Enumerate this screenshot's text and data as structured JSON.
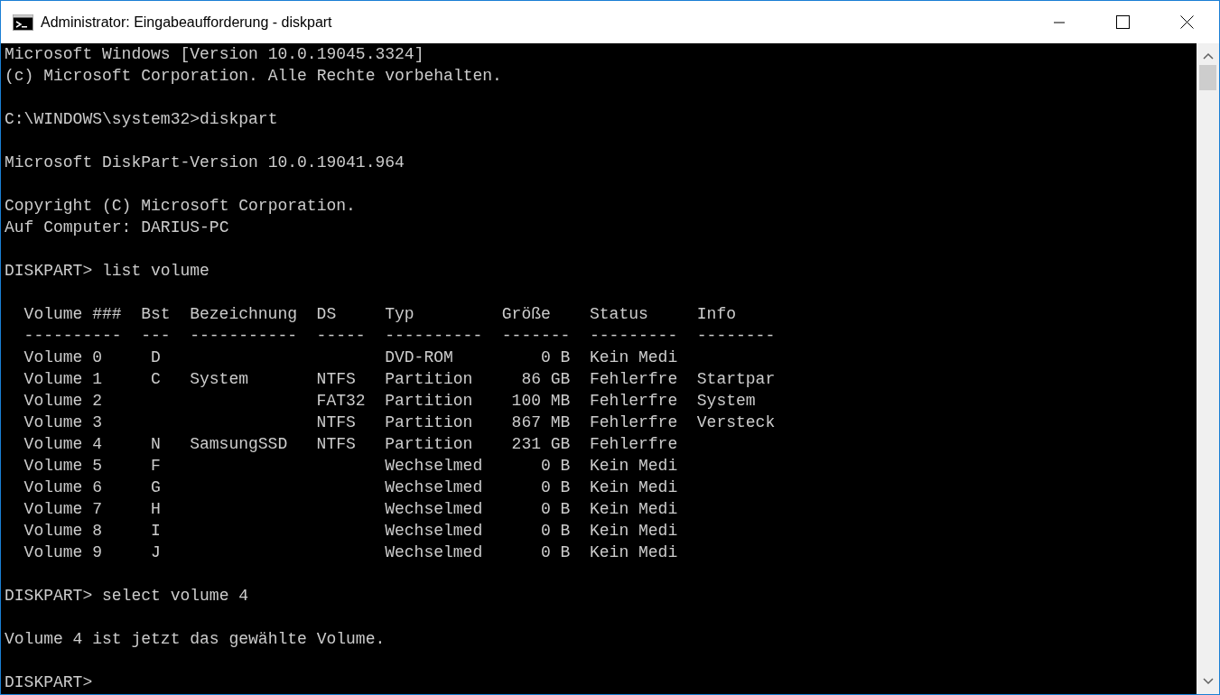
{
  "window": {
    "title": "Administrator: Eingabeaufforderung - diskpart"
  },
  "console_before": [
    [
      "Microsoft Windows [Version 10.0.19045.3324]",
      "(c) Microsoft Corporation. Alle Rechte vorbehalten."
    ],
    [
      "C:\\WINDOWS\\system32>diskpart"
    ],
    [
      "Microsoft DiskPart-Version 10.0.19041.964"
    ],
    [
      "Copyright (C) Microsoft Corporation.",
      "Auf Computer: DARIUS-PC"
    ],
    [
      "DISKPART> list volume"
    ]
  ],
  "table": {
    "columns": [
      "Volume ###",
      "Bst",
      "Bezeichnung",
      "DS",
      "Typ",
      "Größe",
      "Status",
      "Info"
    ],
    "separators": [
      "----------",
      "---",
      "-----------",
      "-----",
      "----------",
      "-------",
      "---------",
      "--------"
    ],
    "rows": [
      {
        "volume": "Volume 0",
        "bst": "D",
        "typ": "DVD-ROM",
        "size": "0 B",
        "status": "Kein Medi"
      },
      {
        "volume": "Volume 1",
        "bst": "C",
        "label": "System",
        "fs": "NTFS",
        "typ": "Partition",
        "size": "86 GB",
        "status": "Fehlerfre",
        "info": "Startpar"
      },
      {
        "volume": "Volume 2",
        "fs": "FAT32",
        "typ": "Partition",
        "size": "100 MB",
        "status": "Fehlerfre",
        "info": "System"
      },
      {
        "volume": "Volume 3",
        "fs": "NTFS",
        "typ": "Partition",
        "size": "867 MB",
        "status": "Fehlerfre",
        "info": "Versteck"
      },
      {
        "volume": "Volume 4",
        "bst": "N",
        "label": "SamsungSSD",
        "fs": "NTFS",
        "typ": "Partition",
        "size": "231 GB",
        "status": "Fehlerfre"
      },
      {
        "volume": "Volume 5",
        "bst": "F",
        "typ": "Wechselmed",
        "size": "0 B",
        "status": "Kein Medi"
      },
      {
        "volume": "Volume 6",
        "bst": "G",
        "typ": "Wechselmed",
        "size": "0 B",
        "status": "Kein Medi"
      },
      {
        "volume": "Volume 7",
        "bst": "H",
        "typ": "Wechselmed",
        "size": "0 B",
        "status": "Kein Medi"
      },
      {
        "volume": "Volume 8",
        "bst": "I",
        "typ": "Wechselmed",
        "size": "0 B",
        "status": "Kein Medi"
      },
      {
        "volume": "Volume 9",
        "bst": "J",
        "typ": "Wechselmed",
        "size": "0 B",
        "status": "Kein Medi"
      }
    ]
  },
  "console_after": [
    [
      "DISKPART> select volume 4"
    ],
    [
      "Volume 4 ist jetzt das gewählte Volume."
    ],
    [
      "DISKPART>"
    ]
  ]
}
